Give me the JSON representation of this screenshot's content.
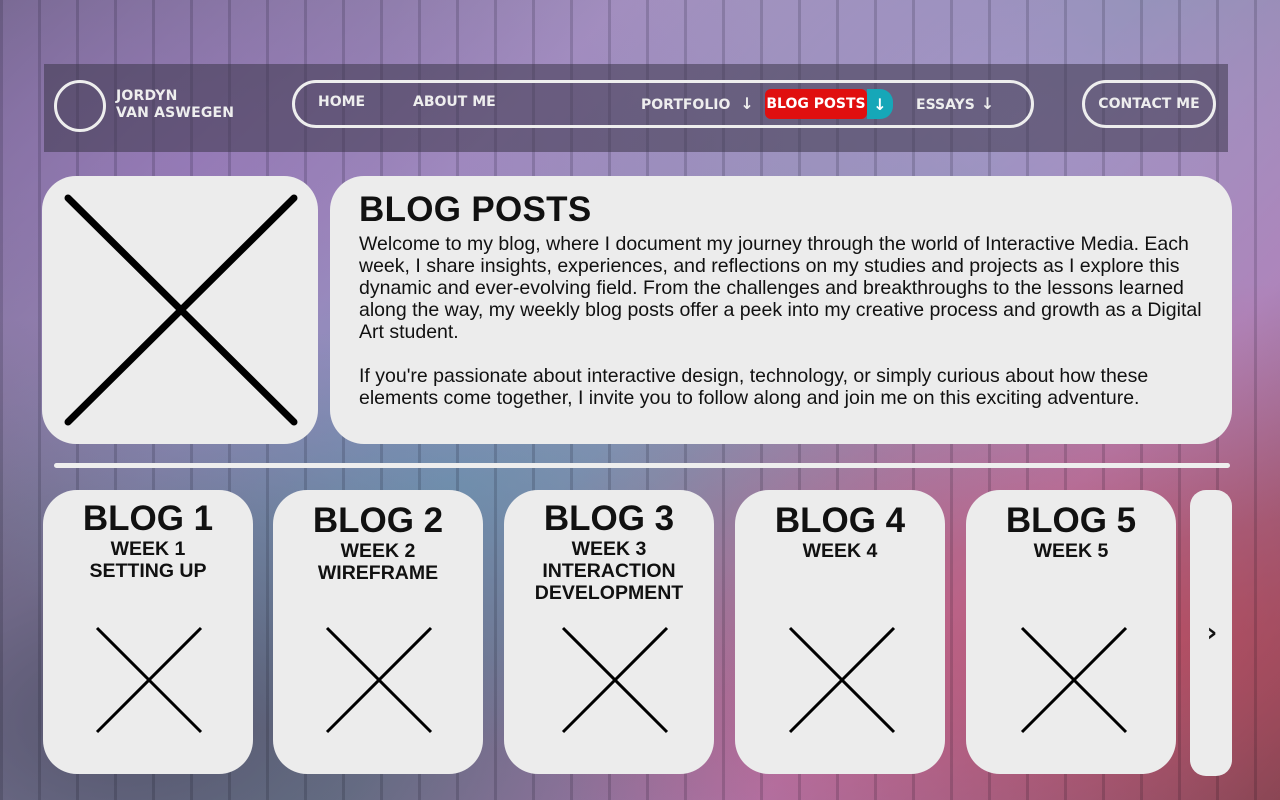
{
  "brand": {
    "line1": "JORDYN",
    "line2": "VAN ASWEGEN"
  },
  "nav": {
    "home": "HOME",
    "about": "ABOUT ME",
    "portfolio": "PORTFOLIO",
    "blog_posts": "BLOG POSTS",
    "essays": "ESSAYS",
    "contact": "CONTACT ME",
    "dropdown_glyph": "↓",
    "active_color": "#e00f0f",
    "accent_color": "#16a7b8"
  },
  "intro": {
    "title": "BLOG POSTS",
    "paragraph1": "Welcome to my blog, where I document my journey through the world of Interactive Media. Each week, I share insights, experiences, and reflections on my studies and projects as I explore this dynamic and ever-evolving field. From the challenges and breakthroughs to the lessons learned along the way, my weekly blog posts offer a peek into my creative process and growth as a Digital Art student.",
    "paragraph2": "If you're passionate about interactive design, technology, or simply curious about how these elements come together, I invite you to follow along and join me on this exciting adventure."
  },
  "cards": [
    {
      "title": "BLOG 1",
      "week": "WEEK 1",
      "topic": "SETTING UP"
    },
    {
      "title": "BLOG 2",
      "week": "WEEK 2",
      "topic": "WIREFRAME"
    },
    {
      "title": "BLOG 3",
      "week": "WEEK 3",
      "topic": "INTERACTION DEVELOPMENT"
    },
    {
      "title": "BLOG 4",
      "week": "WEEK 4",
      "topic": ""
    },
    {
      "title": "BLOG 5",
      "week": "WEEK 5",
      "topic": ""
    }
  ],
  "carousel": {
    "next_glyph": "›"
  },
  "icons": {
    "hero": "image-placeholder-icon",
    "card": "image-placeholder-icon",
    "next": "chevron-right-icon"
  }
}
